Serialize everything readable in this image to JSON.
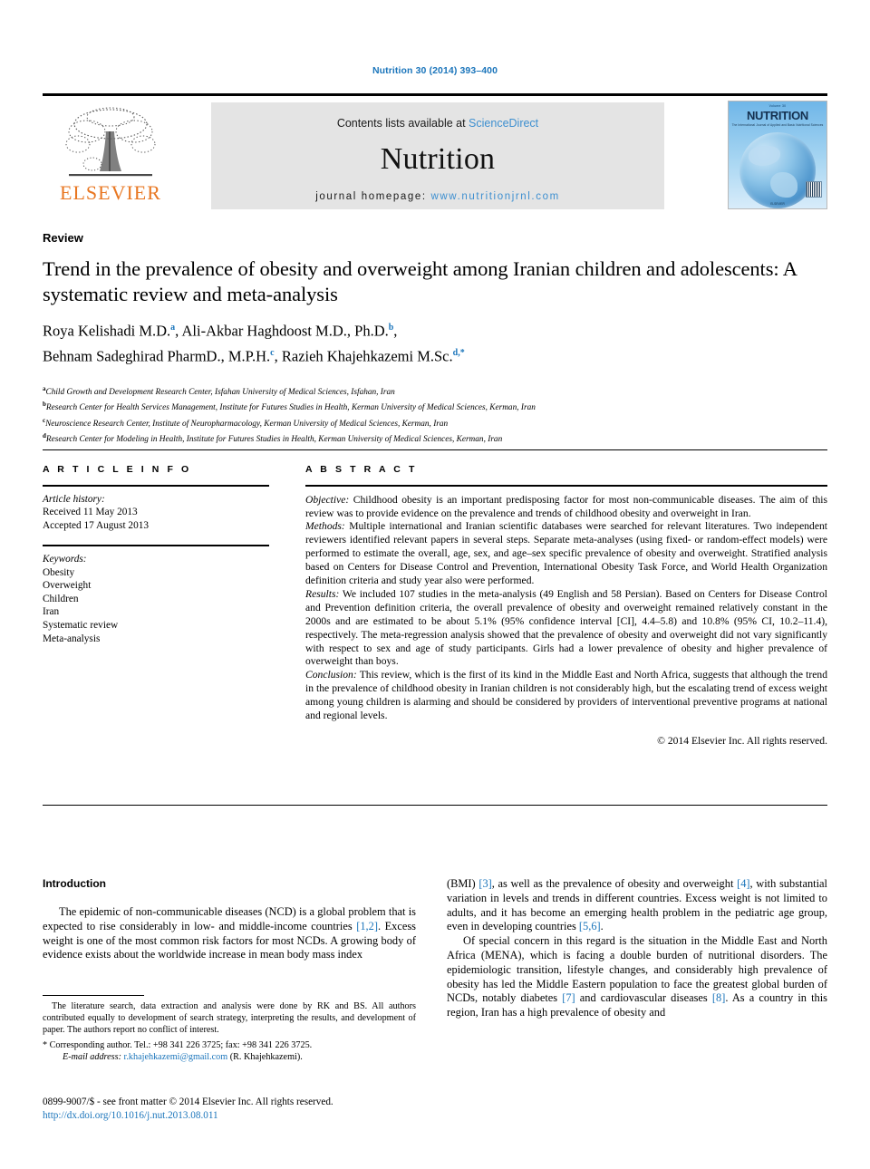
{
  "running_head": "Nutrition 30 (2014) 393–400",
  "masthead": {
    "publisher_logo_text": "ELSEVIER",
    "contents_prefix": "Contents lists available at ",
    "contents_link": "ScienceDirect",
    "journal_title": "Nutrition",
    "homepage_prefix": "journal homepage: ",
    "homepage_url": "www.nutritionjrnl.com",
    "cover": {
      "volume_line": "Volume 30",
      "title": "NUTRITION",
      "subtitle": "The International Journal of Applied and Basic Nutritional Sciences",
      "footer": "ELSEVIER"
    }
  },
  "article": {
    "kicker": "Review",
    "title": "Trend in the prevalence of obesity and overweight among Iranian children and adolescents: A systematic review and meta-analysis",
    "authors_line1": "Roya Kelishadi M.D.",
    "authors_line1_sup1": "a",
    "authors_line1_mid": ", Ali-Akbar Haghdoost M.D., Ph.D.",
    "authors_line1_sup2": "b",
    "authors_line1_end": ",",
    "authors_line2": "Behnam Sadeghirad PharmD., M.P.H.",
    "authors_line2_sup1": "c",
    "authors_line2_mid": ", Razieh Khajehkazemi M.Sc.",
    "authors_line2_sup2": "d,",
    "authors_line2_star": "*",
    "affiliations": [
      {
        "mark": "a",
        "text": "Child Growth and Development Research Center, Isfahan University of Medical Sciences, Isfahan, Iran"
      },
      {
        "mark": "b",
        "text": "Research Center for Health Services Management, Institute for Futures Studies in Health, Kerman University of Medical Sciences, Kerman, Iran"
      },
      {
        "mark": "c",
        "text": "Neuroscience Research Center, Institute of Neuropharmacology, Kerman University of Medical Sciences, Kerman, Iran"
      },
      {
        "mark": "d",
        "text": "Research Center for Modeling in Health, Institute for Futures Studies in Health, Kerman University of Medical Sciences, Kerman, Iran"
      }
    ]
  },
  "info": {
    "heading": "A R T I C L E   I N F O",
    "history_label": "Article history:",
    "history": [
      "Received 11 May 2013",
      "Accepted 17 August 2013"
    ],
    "keywords_label": "Keywords:",
    "keywords": [
      "Obesity",
      "Overweight",
      "Children",
      "Iran",
      "Systematic review",
      "Meta-analysis"
    ]
  },
  "abstract": {
    "heading": "A B S T R A C T",
    "sections": [
      {
        "label": "Objective:",
        "text": " Childhood obesity is an important predisposing factor for most non-communicable diseases. The aim of this review was to provide evidence on the prevalence and trends of childhood obesity and overweight in Iran."
      },
      {
        "label": "Methods:",
        "text": " Multiple international and Iranian scientific databases were searched for relevant literatures. Two independent reviewers identified relevant papers in several steps. Separate meta-analyses (using fixed- or random-effect models) were performed to estimate the overall, age, sex, and age–sex specific prevalence of obesity and overweight. Stratified analysis based on Centers for Disease Control and Prevention, International Obesity Task Force, and World Health Organization definition criteria and study year also were performed."
      },
      {
        "label": "Results:",
        "text": " We included 107 studies in the meta-analysis (49 English and 58 Persian). Based on Centers for Disease Control and Prevention definition criteria, the overall prevalence of obesity and overweight remained relatively constant in the 2000s and are estimated to be about 5.1% (95% confidence interval [CI], 4.4–5.8) and 10.8% (95% CI, 10.2–11.4), respectively. The meta-regression analysis showed that the prevalence of obesity and overweight did not vary significantly with respect to sex and age of study participants. Girls had a lower prevalence of obesity and higher prevalence of overweight than boys."
      },
      {
        "label": "Conclusion:",
        "text": " This review, which is the first of its kind in the Middle East and North Africa, suggests that although the trend in the prevalence of childhood obesity in Iranian children is not considerably high, but the escalating trend of excess weight among young children is alarming and should be considered by providers of interventional preventive programs at national and regional levels."
      }
    ],
    "copyright": "© 2014 Elsevier Inc. All rights reserved."
  },
  "body": {
    "intro_heading": "Introduction",
    "left_paragraph_1_a": "The epidemic of non-communicable diseases (NCD) is a global problem that is expected to rise considerably in low- and middle-income countries ",
    "left_ref_12": "[1,2]",
    "left_paragraph_1_b": ". Excess weight is one of the most common risk factors for most NCDs. A growing body of evidence exists about the worldwide increase in mean body mass index",
    "right_paragraph_1_a": "(BMI) ",
    "right_ref_3": "[3]",
    "right_paragraph_1_b": ", as well as the prevalence of obesity and overweight ",
    "right_ref_4": "[4]",
    "right_paragraph_1_c": ", with substantial variation in levels and trends in different countries. Excess weight is not limited to adults, and it has become an emerging health problem in the pediatric age group, even in developing countries ",
    "right_ref_56": "[5,6]",
    "right_paragraph_1_d": ".",
    "right_paragraph_2_a": "Of special concern in this regard is the situation in the Middle East and North Africa (MENA), which is facing a double burden of nutritional disorders. The epidemiologic transition, lifestyle changes, and considerably high prevalence of obesity has led the Middle Eastern population to face the greatest global burden of NCDs, notably diabetes ",
    "right_ref_7": "[7]",
    "right_paragraph_2_b": " and cardiovascular diseases ",
    "right_ref_8": "[8]",
    "right_paragraph_2_c": ". As a country in this region, Iran has a high prevalence of obesity and"
  },
  "footnotes": {
    "contribution": "The literature search, data extraction and analysis were done by RK and BS. All authors contributed equally to development of search strategy, interpreting the results, and development of paper. The authors report no conflict of interest.",
    "corresponding_star": "*",
    "corresponding": " Corresponding author. Tel.: +98 341 226 3725; fax: +98 341 226 3725.",
    "email_label": "E-mail address:",
    "email": "r.khajehkazemi@gmail.com",
    "email_owner": " (R. Khajehkazemi)."
  },
  "imprint": {
    "issn_line": "0899-9007/$ - see front matter © 2014 Elsevier Inc. All rights reserved.",
    "doi": "http://dx.doi.org/10.1016/j.nut.2013.08.011"
  },
  "colors": {
    "link_blue": "#1b75bb",
    "sciencedirect_blue": "#3d8fd0",
    "elsevier_orange": "#e87722",
    "masthead_grey": "#e4e4e4"
  }
}
